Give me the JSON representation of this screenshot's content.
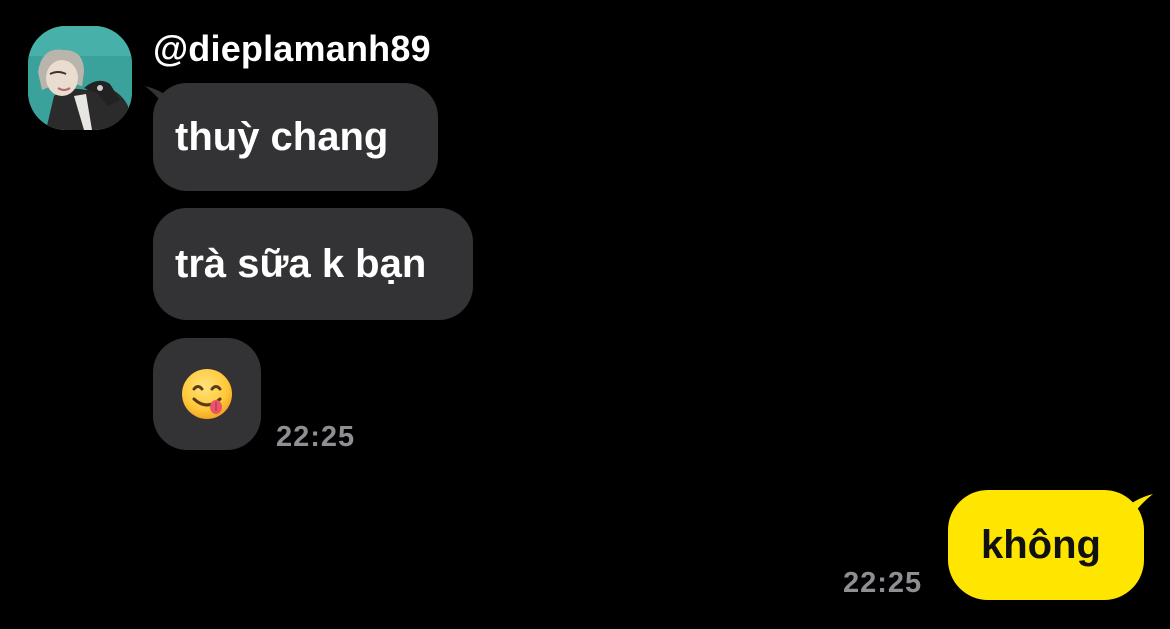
{
  "conversation": {
    "sender": {
      "username": "@dieplamanh89",
      "avatar": "profile-photo"
    },
    "incoming": [
      {
        "text": "thuỳ chang"
      },
      {
        "text": "trà sữa k bạn"
      },
      {
        "emoji": "face-savoring-food-emoji"
      }
    ],
    "incoming_time": "22:25",
    "outgoing": [
      {
        "text": "không"
      }
    ],
    "outgoing_time": "22:25"
  },
  "colors": {
    "background": "#000000",
    "incoming_bubble": "#333336",
    "outgoing_bubble": "#ffe600",
    "timestamp": "#8e8e93"
  }
}
